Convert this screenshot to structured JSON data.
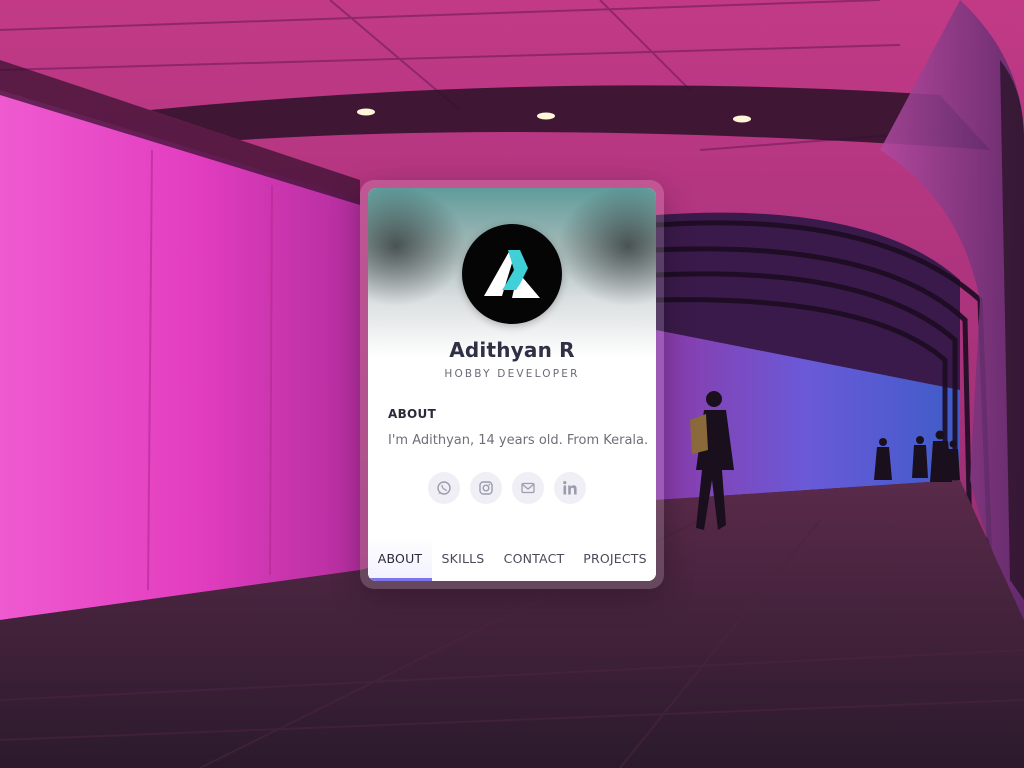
{
  "profile": {
    "name": "Adithyan R",
    "role": "HOBBY DEVELOPER"
  },
  "about": {
    "title": "ABOUT",
    "text": "I'm Adithyan, 14 years old. From Kerala."
  },
  "socials": [
    {
      "icon": "whatsapp-icon"
    },
    {
      "icon": "instagram-icon"
    },
    {
      "icon": "mail-icon"
    },
    {
      "icon": "linkedin-icon"
    }
  ],
  "tabs": [
    {
      "label": "ABOUT",
      "active": true
    },
    {
      "label": "SKILLS",
      "active": false
    },
    {
      "label": "CONTACT",
      "active": false
    },
    {
      "label": "PROJECTS",
      "active": false
    }
  ],
  "colors": {
    "accent": "#7c74eb",
    "name_text": "#2f2f45",
    "logo_cyan": "#3fd0d8",
    "background_magenta": "#e040b8"
  }
}
